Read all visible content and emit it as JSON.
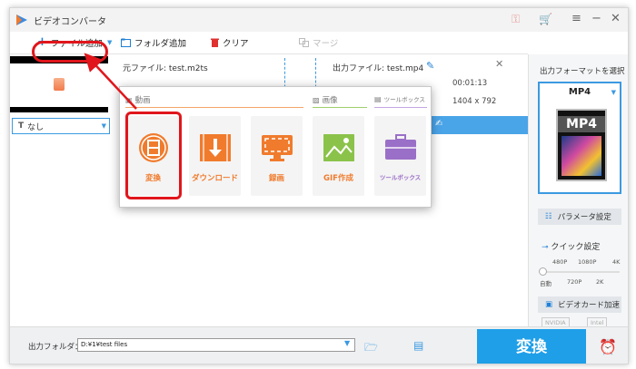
{
  "app": {
    "title": "ビデオコンバータ"
  },
  "toolbar": {
    "add_file": "ファイル追加",
    "add_folder": "フォルダ追加",
    "clear": "クリア",
    "merge": "マージ"
  },
  "file": {
    "source_label": "元ファイル: test.m2ts",
    "output_label": "出力ファイル: test.mp4",
    "duration": "00:01:13",
    "resolution": "1404 x 792",
    "subtitle": "なし"
  },
  "popup": {
    "categories": [
      "動画",
      "画像",
      "ツールボックス"
    ],
    "tiles": [
      {
        "label": "変換",
        "color": "#f07b2d"
      },
      {
        "label": "ダウンロード",
        "color": "#f07b2d"
      },
      {
        "label": "録画",
        "color": "#f07b2d"
      },
      {
        "label": "GIF作成",
        "color": "#f07b2d"
      },
      {
        "label": "ツールボックス",
        "color": "#9a6fc8"
      }
    ]
  },
  "right": {
    "title": "出力フォーマットを選択",
    "format": "MP4",
    "format_art": "MP4",
    "param_settings": "パラメータ設定",
    "quick_settings": "クイック設定",
    "quality_top": [
      "480P",
      "1080P",
      "4K"
    ],
    "quality_bottom": [
      "自動",
      "720P",
      "2K"
    ],
    "gpu_accel": "ビデオカード加速",
    "gpu_chips": [
      "NVIDIA",
      "Intel"
    ]
  },
  "bottom": {
    "output_folder_label": "出力フォルダ：",
    "output_folder_value": "D:¥1¥test files",
    "convert": "変換"
  },
  "colors": {
    "accent": "#1f9fe8",
    "highlight": "#e0161c",
    "tile_orange": "#f07b2d",
    "tile_green": "#8bc34a",
    "tile_purple": "#9a6fc8"
  }
}
